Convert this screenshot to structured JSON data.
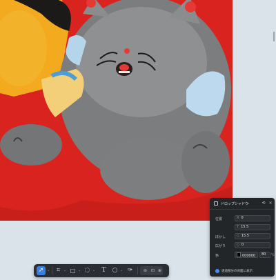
{
  "panel": {
    "title": "ドロップシャドウ",
    "rows": [
      {
        "label": "位置",
        "x_prefix": "X",
        "x_value": "0",
        "y_prefix": "Y",
        "y_value": "15.5"
      },
      {
        "label": "ぼかし",
        "value_prefix": "◇",
        "value": "15.5"
      },
      {
        "label": "広がり",
        "value_prefix": "◇",
        "value": "0"
      },
      {
        "label": "色",
        "hex": "000000",
        "opacity": "80",
        "unit": "%"
      }
    ],
    "footer_label": "透過部分の背面に表示"
  },
  "toolbar": {
    "tools": [
      "select-arrow",
      "crop",
      "rectangle",
      "lasso",
      "text",
      "ellipse",
      "pen"
    ]
  },
  "colors": {
    "panel_bg": "#232629",
    "accent": "#3d7fe0",
    "photo_red": "#d8231e"
  }
}
